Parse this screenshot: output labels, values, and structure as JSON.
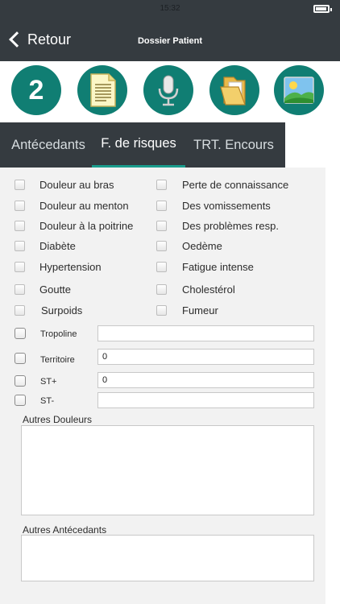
{
  "status_bar": {
    "time": "15:32"
  },
  "nav": {
    "back_label": "Retour",
    "title": "Dossier Patient"
  },
  "icon_bar": {
    "badge_number": "2",
    "accent_color": "#107e73"
  },
  "tabs": [
    {
      "label": "Antécedants",
      "active": false
    },
    {
      "label": "F. de risques",
      "active": true
    },
    {
      "label": "TRT. Encours",
      "active": false
    }
  ],
  "risk_factors": {
    "left": [
      "Douleur au bras",
      "Douleur au menton",
      "Douleur à la poitrine",
      "Diabète",
      "Hypertension",
      "Goutte",
      "Surpoids"
    ],
    "right": [
      "Perte de connaissance",
      "Des vomissements",
      "Des problèmes resp.",
      "Oedème",
      "Fatigue intense",
      "Cholestérol",
      "Fumeur"
    ]
  },
  "fields": [
    {
      "label": "Tropoline",
      "value": ""
    },
    {
      "label": "Territoire",
      "value": "0"
    },
    {
      "label": "ST+",
      "value": "0"
    },
    {
      "label": "ST-",
      "value": ""
    }
  ],
  "other_pain": {
    "label": "Autres Douleurs",
    "value": ""
  },
  "other_history": {
    "label": "Autres Antécedants",
    "value": ""
  }
}
